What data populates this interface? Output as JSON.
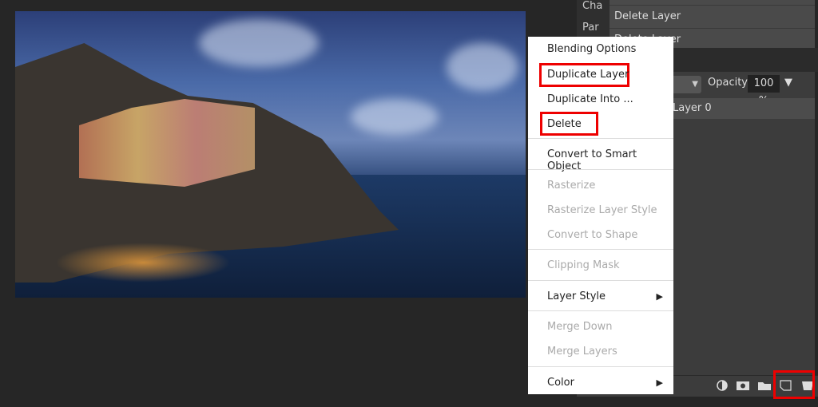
{
  "side_tabs": [
    "Cha",
    "Par"
  ],
  "history": {
    "items": [
      "Delete Layer",
      "Delete Layer"
    ]
  },
  "layers_panel": {
    "opacity_label": "Opacity:",
    "opacity_value": "100 %",
    "layer_name": "Layer 0",
    "toolbar_icons": [
      "adjustment-icon",
      "mask-icon",
      "folder-icon",
      "new-layer-icon",
      "trash-icon"
    ]
  },
  "context_menu": {
    "items": [
      {
        "label": "Blending Options",
        "enabled": true
      },
      {
        "label": "Duplicate Layer",
        "enabled": true,
        "highlighted": true
      },
      {
        "label": "Duplicate Into ...",
        "enabled": true
      },
      {
        "label": "Delete",
        "enabled": true,
        "highlighted": true
      },
      {
        "label": "Convert to Smart Object",
        "enabled": true
      },
      {
        "label": "Rasterize",
        "enabled": false
      },
      {
        "label": "Rasterize Layer Style",
        "enabled": false
      },
      {
        "label": "Convert to Shape",
        "enabled": false
      },
      {
        "label": "Clipping Mask",
        "enabled": false
      },
      {
        "label": "Layer Style",
        "enabled": true,
        "submenu": true
      },
      {
        "label": "Merge Down",
        "enabled": false
      },
      {
        "label": "Merge Layers",
        "enabled": false
      },
      {
        "label": "Color",
        "enabled": true,
        "submenu": true
      }
    ]
  },
  "colors": {
    "highlight": "#e00000",
    "background": "#262626"
  }
}
